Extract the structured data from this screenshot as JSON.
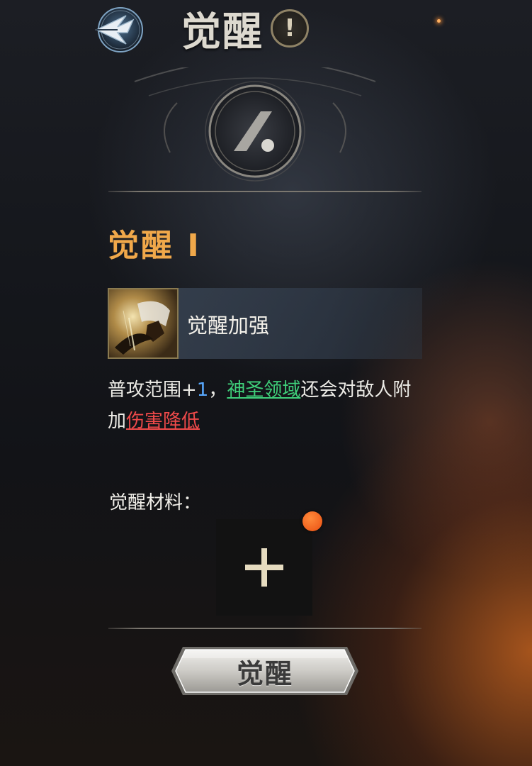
{
  "header": {
    "title": "觉醒",
    "info_label": "!",
    "back_icon": "back-arrow-icon"
  },
  "emblem": {
    "icon": "slash-dot-icon"
  },
  "awakening": {
    "level_title": "觉醒 Ⅰ",
    "skill": {
      "name": "觉醒加强",
      "icon": "sword-skill-icon"
    },
    "description": {
      "part1": "普攻范围+",
      "num": "1",
      "part2": "，",
      "link1": "神圣领域",
      "part3": "还会对敌人附加",
      "link2": "伤害降低"
    }
  },
  "materials": {
    "label": "觉醒材料：",
    "slot_icon": "plus-icon",
    "has_notification": true
  },
  "action": {
    "awaken_label": "觉醒"
  },
  "colors": {
    "level_title": "#f0a84a",
    "highlight_num": "#58a8ff",
    "link_green": "#3fd07a",
    "link_red": "#ef4a4a",
    "notification": "#ea4f12"
  }
}
